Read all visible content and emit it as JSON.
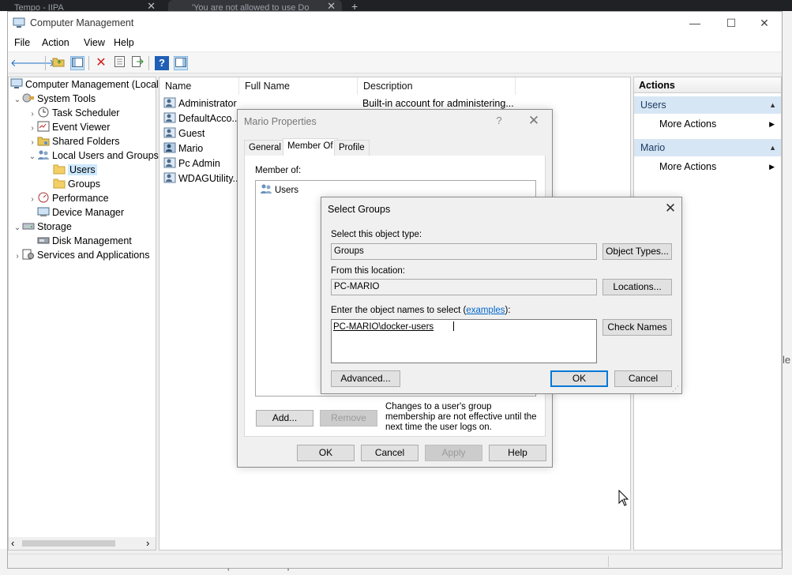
{
  "browser": {
    "tabs": [
      {
        "label": "Tempo - IIPA"
      },
      {
        "label": "'You are not allowed to use Do"
      }
    ],
    "new_tab": "+",
    "bottom_text": "MAC | WINDOWS | LINUX",
    "side_text": "le"
  },
  "window": {
    "title": "Computer Management",
    "controls": {
      "minimize": "—",
      "maximize": "☐",
      "close": "✕"
    }
  },
  "menu": [
    "File",
    "Action",
    "View",
    "Help"
  ],
  "tree": {
    "items": [
      {
        "label": "Computer Management (Local",
        "exp": "",
        "icon": "computer-management-icon"
      },
      {
        "label": "System Tools",
        "exp": "⌄",
        "icon": "system-tools-icon"
      },
      {
        "label": "Task Scheduler",
        "exp": "›",
        "icon": "clock-icon"
      },
      {
        "label": "Event Viewer",
        "exp": "›",
        "icon": "event-viewer-icon"
      },
      {
        "label": "Shared Folders",
        "exp": "›",
        "icon": "shared-folder-icon"
      },
      {
        "label": "Local Users and Groups",
        "exp": "⌄",
        "icon": "users-groups-icon"
      },
      {
        "label": "Users",
        "exp": "",
        "icon": "folder-icon"
      },
      {
        "label": "Groups",
        "exp": "",
        "icon": "folder-icon"
      },
      {
        "label": "Performance",
        "exp": "›",
        "icon": "performance-icon"
      },
      {
        "label": "Device Manager",
        "exp": "",
        "icon": "device-manager-icon"
      },
      {
        "label": "Storage",
        "exp": "⌄",
        "icon": "storage-icon"
      },
      {
        "label": "Disk Management",
        "exp": "",
        "icon": "disk-icon"
      },
      {
        "label": "Services and Applications",
        "exp": "›",
        "icon": "services-icon"
      }
    ],
    "scroll_left": "‹",
    "scroll_right": "›"
  },
  "list": {
    "columns": [
      "Name",
      "Full Name",
      "Description"
    ],
    "rows": [
      {
        "name": "Administrator",
        "full_name": "",
        "description": "Built-in account for administering..."
      },
      {
        "name": "DefaultAcco...",
        "full_name": "",
        "description": ""
      },
      {
        "name": "Guest",
        "full_name": "",
        "description": ""
      },
      {
        "name": "Mario",
        "full_name": "",
        "description": ""
      },
      {
        "name": "Pc Admin",
        "full_name": "",
        "description": ""
      },
      {
        "name": "WDAGUtility...",
        "full_name": "",
        "description": ""
      }
    ]
  },
  "actions": {
    "title": "Actions",
    "sections": [
      {
        "header": "Users",
        "item": "More Actions"
      },
      {
        "header": "Mario",
        "item": "More Actions"
      }
    ]
  },
  "props": {
    "title": "Mario Properties",
    "help": "?",
    "close": "✕",
    "tabs": [
      "General",
      "Member Of",
      "Profile"
    ],
    "member_of_label": "Member of:",
    "member_of_items": [
      "Users"
    ],
    "add": "Add...",
    "remove": "Remove",
    "note": "Changes to a user's group membership are not effective until the next time the user logs on.",
    "ok": "OK",
    "cancel": "Cancel",
    "apply": "Apply",
    "help_btn": "Help"
  },
  "select_groups": {
    "title": "Select Groups",
    "close": "✕",
    "object_type_label": "Select this object type:",
    "object_type_value": "Groups",
    "object_types_button": "Object Types...",
    "location_label": "From this location:",
    "location_value": "PC-MARIO",
    "locations_button": "Locations...",
    "names_label_prefix": "Enter the object names to select (",
    "names_label_link": "examples",
    "names_label_suffix": "):",
    "names_value": "PC-MARIO\\docker-users",
    "check_names": "Check Names",
    "advanced": "Advanced...",
    "ok": "OK",
    "cancel": "Cancel"
  },
  "colors": {
    "accent": "#0078d7",
    "selection": "#cce8ff",
    "actions_header": "#d7e6f4"
  }
}
